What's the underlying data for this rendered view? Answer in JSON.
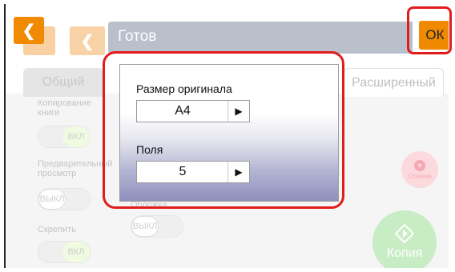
{
  "header": {
    "title": "Готов",
    "ok_label": "ОК"
  },
  "tabs": [
    {
      "label": "Общий"
    },
    {
      "label": "Расширенный"
    }
  ],
  "settings": {
    "book_copy_label": "Копирование книги",
    "book_copy_state": "ВКЛ",
    "preview_label": "Предварительный просмотр",
    "preview_state": "ВЫКЛ",
    "staple_label": "Скрепить",
    "staple_state": "ВКЛ",
    "cover_label": "Обложка",
    "cover_state": "ВЫКЛ"
  },
  "actions": {
    "cancel_label": "Отмена",
    "copy_label": "Копия"
  },
  "popup": {
    "original_size_label": "Размер оригинала",
    "original_size_value": "A4",
    "margins_label": "Поля",
    "margins_value": "5"
  },
  "icons": {
    "back": "chevron-left-icon",
    "select_arrow": "triangle-right-icon",
    "cancel": "stop-icon",
    "copy": "start-diamond-icon"
  },
  "colors": {
    "accent": "#f08a00",
    "highlight": "#e21b1b",
    "title_bar": "#b9bfcb"
  }
}
